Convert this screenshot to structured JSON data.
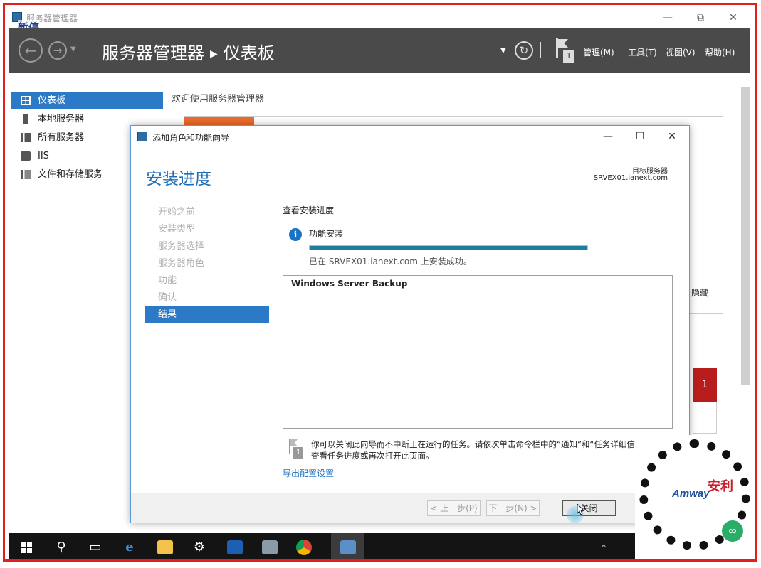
{
  "window": {
    "title": "服务器管理器",
    "overlay_pause": "暂停"
  },
  "header": {
    "app_name": "服务器管理器",
    "page_name": "仪表板",
    "notification_count": "1",
    "menus": [
      "管理(M)",
      "工具(T)",
      "视图(V)",
      "帮助(H)"
    ]
  },
  "sidebar": {
    "items": [
      {
        "label": "仪表板",
        "icon": "dashboard-icon"
      },
      {
        "label": "本地服务器",
        "icon": "server-icon"
      },
      {
        "label": "所有服务器",
        "icon": "servers-icon"
      },
      {
        "label": "IIS",
        "icon": "iis-icon"
      },
      {
        "label": "文件和存储服务",
        "icon": "storage-icon"
      }
    ]
  },
  "main": {
    "welcome": "欢迎使用服务器管理器",
    "hide_label": "隐藏",
    "tile_count": "1"
  },
  "wizard": {
    "title": "添加角色和功能向导",
    "heading": "安装进度",
    "target_label": "目标服务器",
    "target_server": "SRVEX01.ianext.com",
    "steps": [
      "开始之前",
      "安装类型",
      "服务器选择",
      "服务器角色",
      "功能",
      "确认",
      "结果"
    ],
    "current_step": 6,
    "view_progress": "查看安装进度",
    "info_icon": "i",
    "feature_install": "功能安装",
    "progress": 1.0,
    "success_msg": "已在 SRVEX01.ianext.com 上安装成功。",
    "result_item": "Windows Server Backup",
    "note_badge": "1",
    "note_line1": "你可以关闭此向导而不中断正在运行的任务。请依次单击命令栏中的“通知”和“任务详细信息”，以",
    "note_line2": "查看任务进度或再次打开此页面。",
    "export_link": "导出配置设置",
    "buttons": {
      "prev": "< 上一步(P)",
      "next": "下一步(N) >",
      "close": "关闭"
    }
  },
  "taskbar": {
    "items": [
      "start-icon",
      "search-icon",
      "task-view-icon",
      "ie-icon",
      "file-explorer-icon",
      "settings-icon",
      "exchange-icon",
      "tool-icon",
      "chrome-icon",
      "server-manager-icon"
    ],
    "tray_ime": "中"
  },
  "qr": {
    "brand": "Amway",
    "chinese": "安利"
  },
  "colors": {
    "accent": "#2b79c7",
    "header_bg": "#4a4a4a",
    "progress": "#1f7f9a",
    "frame": "#e01f1f",
    "orange": "#ee6b2a"
  }
}
